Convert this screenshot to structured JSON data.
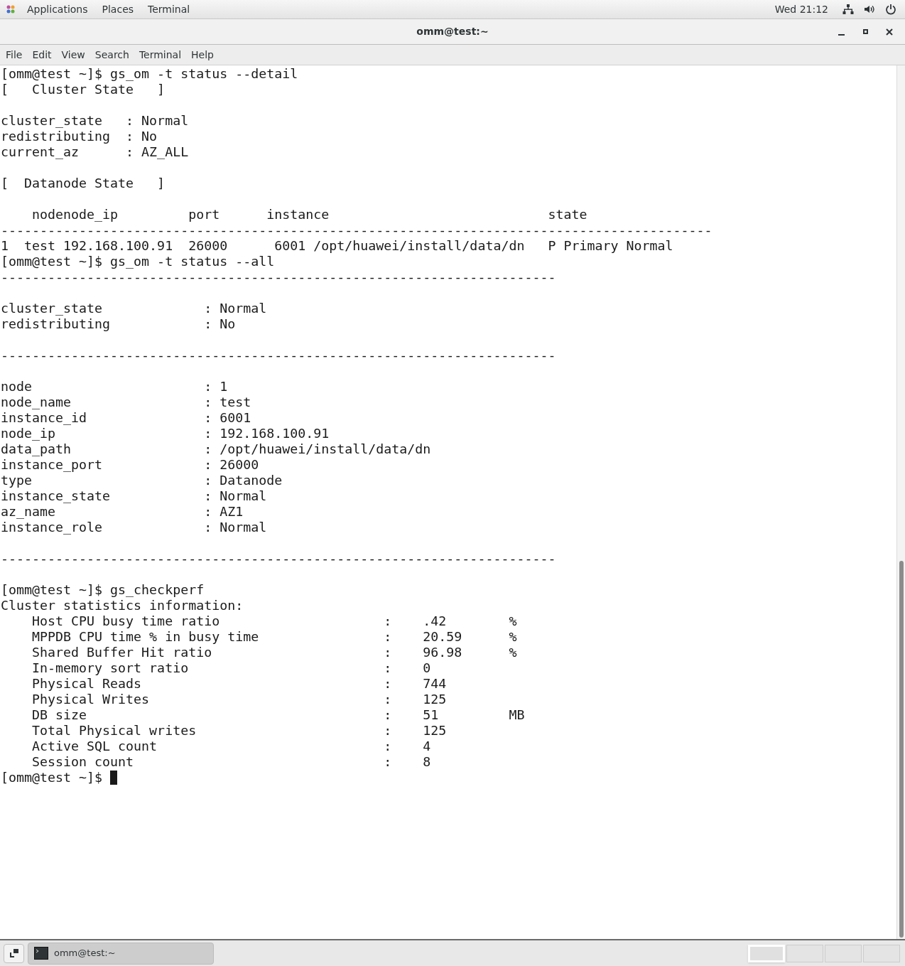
{
  "top_panel": {
    "menus": [
      "Applications",
      "Places",
      "Terminal"
    ],
    "clock": "Wed 21:12"
  },
  "window": {
    "title": "omm@test:~"
  },
  "menu_bar": [
    "File",
    "Edit",
    "View",
    "Search",
    "Terminal",
    "Help"
  ],
  "terminal": {
    "lines": [
      {
        "kind": "text",
        "text": "[omm@test ~]$ gs_om -t status --detail"
      },
      {
        "kind": "text",
        "text": "[   Cluster State   ]"
      },
      {
        "kind": "blank"
      },
      {
        "kind": "text",
        "text": "cluster_state   : Normal"
      },
      {
        "kind": "text",
        "text": "redistributing  : No"
      },
      {
        "kind": "text",
        "text": "current_az      : AZ_ALL"
      },
      {
        "kind": "blank"
      },
      {
        "kind": "text",
        "text": "[  Datanode State   ]"
      },
      {
        "kind": "blank"
      },
      {
        "kind": "text",
        "text": "    nodenode_ip         port      instance                            state"
      },
      {
        "kind": "text",
        "text": "-------------------------------------------------------------------------------------------"
      },
      {
        "kind": "text",
        "text": "1  test 192.168.100.91  26000      6001 /opt/huawei/install/data/dn   P Primary Normal"
      },
      {
        "kind": "text",
        "text": "[omm@test ~]$ gs_om -t status --all"
      },
      {
        "kind": "text",
        "text": "-----------------------------------------------------------------------"
      },
      {
        "kind": "blank"
      },
      {
        "kind": "text",
        "text": "cluster_state             : Normal"
      },
      {
        "kind": "text",
        "text": "redistributing            : No"
      },
      {
        "kind": "blank"
      },
      {
        "kind": "text",
        "text": "-----------------------------------------------------------------------"
      },
      {
        "kind": "blank"
      },
      {
        "kind": "text",
        "text": "node                      : 1"
      },
      {
        "kind": "text",
        "text": "node_name                 : test"
      },
      {
        "kind": "text",
        "text": "instance_id               : 6001"
      },
      {
        "kind": "text",
        "text": "node_ip                   : 192.168.100.91"
      },
      {
        "kind": "text",
        "text": "data_path                 : /opt/huawei/install/data/dn"
      },
      {
        "kind": "text",
        "text": "instance_port             : 26000"
      },
      {
        "kind": "text",
        "text": "type                      : Datanode"
      },
      {
        "kind": "text",
        "text": "instance_state            : Normal"
      },
      {
        "kind": "text",
        "text": "az_name                   : AZ1"
      },
      {
        "kind": "text",
        "text": "instance_role             : Normal"
      },
      {
        "kind": "blank"
      },
      {
        "kind": "text",
        "text": "-----------------------------------------------------------------------"
      },
      {
        "kind": "blank"
      },
      {
        "kind": "text",
        "text": "[omm@test ~]$ gs_checkperf"
      },
      {
        "kind": "text",
        "text": "Cluster statistics information:"
      },
      {
        "kind": "text",
        "text": "    Host CPU busy time ratio                     :    .42        %"
      },
      {
        "kind": "text",
        "text": "    MPPDB CPU time % in busy time                :    20.59      %"
      },
      {
        "kind": "text",
        "text": "    Shared Buffer Hit ratio                      :    96.98      %"
      },
      {
        "kind": "text",
        "text": "    In-memory sort ratio                         :    0"
      },
      {
        "kind": "text",
        "text": "    Physical Reads                               :    744"
      },
      {
        "kind": "text",
        "text": "    Physical Writes                              :    125"
      },
      {
        "kind": "text",
        "text": "    DB size                                      :    51         MB"
      },
      {
        "kind": "text",
        "text": "    Total Physical writes                        :    125"
      },
      {
        "kind": "text",
        "text": "    Active SQL count                             :    4"
      },
      {
        "kind": "text",
        "text": "    Session count                                :    8"
      },
      {
        "kind": "prompt",
        "text": "[omm@test ~]$ "
      }
    ]
  },
  "taskbar": {
    "task": "omm@test:~",
    "workspaces": [
      {
        "selected": true
      },
      {
        "selected": false
      },
      {
        "selected": false
      },
      {
        "selected": false
      }
    ]
  }
}
